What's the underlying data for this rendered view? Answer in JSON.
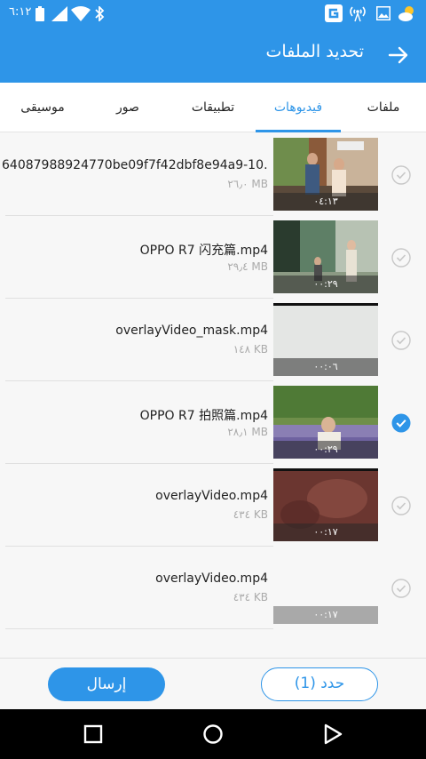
{
  "status_bar": {
    "time": "٦:١٢",
    "icons": [
      "battery-icon",
      "signal-icon",
      "wifi-icon",
      "bluetooth-icon",
      "app-g-icon",
      "hotspot-icon",
      "gallery-icon",
      "weather-icon"
    ]
  },
  "header": {
    "title": "تحديد الملفات",
    "back_icon": "arrow-right-icon"
  },
  "tabs": [
    {
      "label": "ملفات",
      "active": false
    },
    {
      "label": "فيديوهات",
      "active": true
    },
    {
      "label": "تطبيقات",
      "active": false
    },
    {
      "label": "صور",
      "active": false
    },
    {
      "label": "موسيقى",
      "active": false
    }
  ],
  "files": [
    {
      "name": "64087988924770be09f7f42dbf8e94a9-10…",
      "size": "٢٦٫٠ MB",
      "duration": "٠٤:١٣",
      "checked": false
    },
    {
      "name": "OPPO R7 闪充篇.mp4",
      "size": "٢٩٫٤ MB",
      "duration": "٠٠:٢٩",
      "checked": false
    },
    {
      "name": "overlayVideo_mask.mp4",
      "size": "١٤٨ KB",
      "duration": "٠٠:٠٦",
      "checked": false
    },
    {
      "name": "OPPO R7 拍照篇.mp4",
      "size": "٢٨٫١ MB",
      "duration": "٠٠:٢٩",
      "checked": true
    },
    {
      "name": "overlayVideo.mp4",
      "size": "٤٣٤ KB",
      "duration": "٠٠:١٧",
      "checked": false
    },
    {
      "name": "overlayVideo.mp4",
      "size": "٤٣٤ KB",
      "duration": "٠٠:١٧",
      "checked": false
    }
  ],
  "bottom": {
    "send_label": "إرسال",
    "select_label": "حدد (1)"
  },
  "colors": {
    "accent": "#2e95e8",
    "check_gray": "#c8c8c8"
  }
}
